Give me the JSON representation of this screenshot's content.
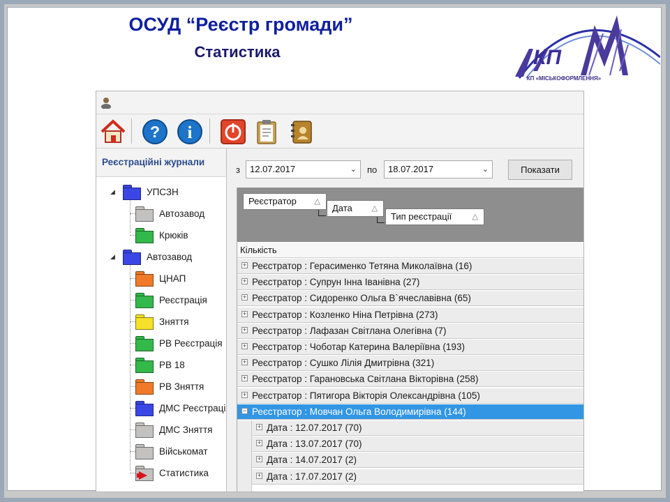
{
  "slide": {
    "title": "ОСУД “Реєстр громади”",
    "subtitle": "Статистика",
    "logo_text": "КП",
    "logo_caption": "КП «МІСЬКОФОРМЛЕННЯ»"
  },
  "toolbar": {
    "buttons": [
      {
        "name": "home-button",
        "icon": "home-icon"
      },
      {
        "name": "help-button",
        "icon": "question-icon"
      },
      {
        "name": "info-button",
        "icon": "info-icon"
      },
      {
        "name": "exit-button",
        "icon": "power-icon"
      },
      {
        "name": "clipboard-button",
        "icon": "clipboard-icon"
      },
      {
        "name": "book-button",
        "icon": "address-book-icon"
      }
    ]
  },
  "sidebar": {
    "header": "Реєстраційні журнали",
    "items": [
      {
        "label": "УПСЗН",
        "color": "#3a46e6",
        "level": 0,
        "expanded": true
      },
      {
        "label": "Автозавод",
        "color": "#c4c2c0",
        "level": 1
      },
      {
        "label": "Крюків",
        "color": "#33b84a",
        "level": 1
      },
      {
        "label": "Автозавод",
        "color": "#3a46e6",
        "level": 0,
        "expanded": true
      },
      {
        "label": "ЦНАП",
        "color": "#f07a2a",
        "level": 1
      },
      {
        "label": "Реєстрація",
        "color": "#33b84a",
        "level": 1
      },
      {
        "label": "Зняття",
        "color": "#f5e12a",
        "level": 1
      },
      {
        "label": "РВ Реєстрація",
        "color": "#33b84a",
        "level": 1
      },
      {
        "label": "РВ 18",
        "color": "#33b84a",
        "level": 1
      },
      {
        "label": "РВ Зняття",
        "color": "#f07a2a",
        "level": 1
      },
      {
        "label": "ДМС Реєстрація",
        "color": "#3a46e6",
        "level": 1
      },
      {
        "label": "ДМС Зняття",
        "color": "#c4c2c0",
        "level": 1
      },
      {
        "label": "Військомат",
        "color": "#c4c2c0",
        "level": 1
      },
      {
        "label": "Статистика",
        "color": "#c4c2c0",
        "level": 1,
        "icon": "red-arrow-icon"
      }
    ]
  },
  "filter": {
    "from_label": "з",
    "from_value": "12.07.2017",
    "to_label": "по",
    "to_value": "18.07.2017",
    "show_button": "Показати"
  },
  "grid": {
    "group_chips": [
      "Реєстратор",
      "Дата",
      "Тип реєстрації"
    ],
    "column_header": "Кількість",
    "rows": [
      {
        "text": "Реєстратор : Герасименко Тетяна Миколаївна (16)",
        "expanded": false
      },
      {
        "text": "Реєстратор : Супрун Інна Іванівна (27)",
        "expanded": false
      },
      {
        "text": "Реєстратор : Сидоренко Ольга В`ячеславівна (65)",
        "expanded": false
      },
      {
        "text": "Реєстратор : Козленко Ніна Петрівна (273)",
        "expanded": false
      },
      {
        "text": "Реєстратор : Лафазан Світлана Олегівна (7)",
        "expanded": false
      },
      {
        "text": "Реєстратор : Чоботар Катерина Валеріївна (193)",
        "expanded": false
      },
      {
        "text": "Реєстратор : Сушко Лілія Дмитрівна (321)",
        "expanded": false
      },
      {
        "text": "Реєстратор : Гарановська Світлана Вікторівна (258)",
        "expanded": false
      },
      {
        "text": "Реєстратор : Пятигора Вікторія Олександрівна (105)",
        "expanded": false
      },
      {
        "text": "Реєстратор : Мовчан Ольга Володимирівна (144)",
        "expanded": true,
        "selected": true
      }
    ],
    "child_rows": [
      {
        "text": "Дата : 12.07.2017 (70)"
      },
      {
        "text": "Дата : 13.07.2017 (70)"
      },
      {
        "text": "Дата : 14.07.2017 (2)"
      },
      {
        "text": "Дата : 17.07.2017 (2)"
      }
    ]
  }
}
